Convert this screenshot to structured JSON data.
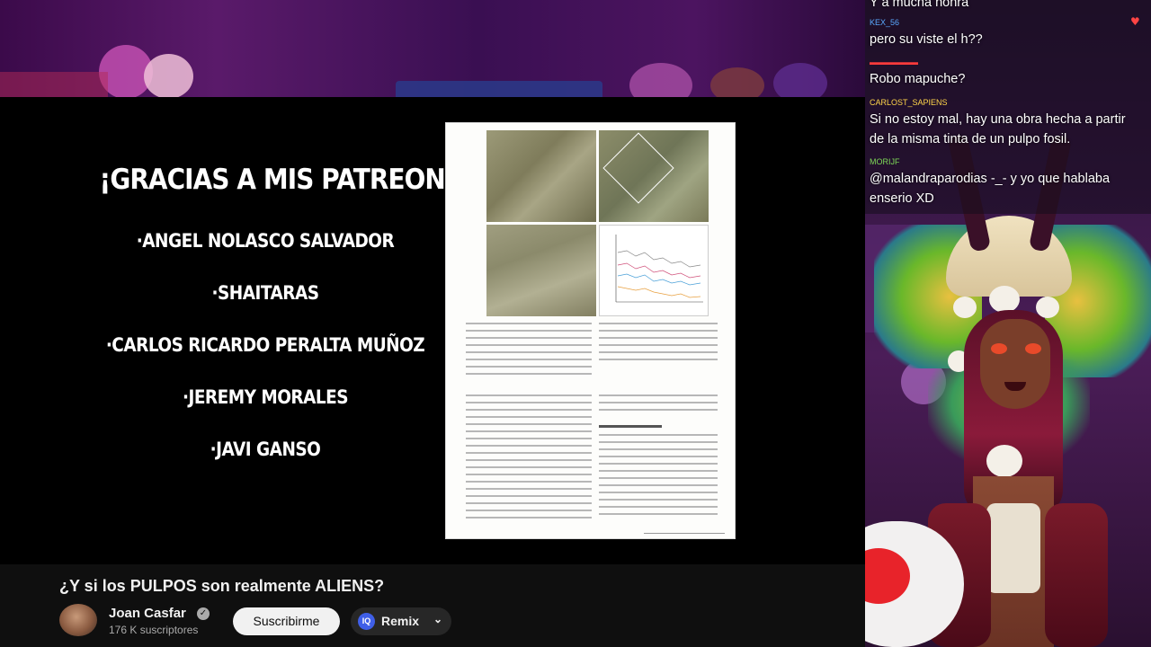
{
  "video": {
    "thanks_title": "¡GRACIAS A MIS PATREON!",
    "patrons": [
      "·ANGEL NOLASCO SALVADOR",
      "·SHAITARAS",
      "·CARLOS RICARDO PERALTA MUÑOZ",
      "·JEREMY MORALES",
      "·JAVI GANSO"
    ]
  },
  "youtube": {
    "video_title": "¿Y si los PULPOS son realmente ALIENS?",
    "channel_name": "Joan Casfar",
    "subscribers": "176 K suscriptores",
    "subscribe_label": "Suscribirme",
    "remix_label": "Remix",
    "remix_icon_text": "IQ"
  },
  "chat": {
    "messages": [
      {
        "user": "",
        "text": "Y a mucha honra",
        "user_color": "#ffffff"
      },
      {
        "user": "KEX_56",
        "text": "pero su viste el h??",
        "user_color": "#5aa9ff"
      },
      {
        "user": "",
        "text": "Robo mapuche?",
        "user_color": "#ff3b3b"
      },
      {
        "user": "CARLOST_SAPIENS",
        "text": "Si no estoy mal, hay una obra hecha a partir de la misma tinta de un pulpo fosil.",
        "user_color": "#ffd54a"
      },
      {
        "user": "MORIJF",
        "text": "@malandraparodias -_- y yo que hablaba enserio XD",
        "user_color": "#7ed957"
      }
    ]
  },
  "colors": {
    "subscribe_bg": "#f1f1f1",
    "remix_accent": "#3f5fe8",
    "banner": "#4c1460"
  }
}
